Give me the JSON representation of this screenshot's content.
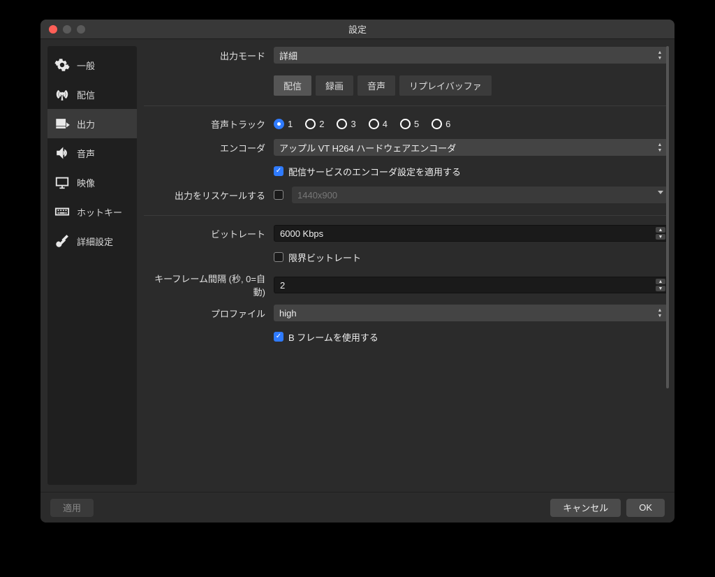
{
  "window": {
    "title": "設定"
  },
  "sidebar": {
    "items": [
      {
        "label": "一般"
      },
      {
        "label": "配信"
      },
      {
        "label": "出力"
      },
      {
        "label": "音声"
      },
      {
        "label": "映像"
      },
      {
        "label": "ホットキー"
      },
      {
        "label": "詳細設定"
      }
    ],
    "active_index": 2
  },
  "output_mode": {
    "label": "出力モード",
    "value": "詳細"
  },
  "tabs": [
    {
      "label": "配信"
    },
    {
      "label": "録画"
    },
    {
      "label": "音声"
    },
    {
      "label": "リプレイバッファ"
    }
  ],
  "tabs_active_index": 0,
  "audio_track": {
    "label": "音声トラック",
    "options": [
      "1",
      "2",
      "3",
      "4",
      "5",
      "6"
    ],
    "selected_index": 0
  },
  "encoder": {
    "label": "エンコーダ",
    "value": "アップル VT H264 ハードウェアエンコーダ"
  },
  "apply_service_settings": {
    "checked": true,
    "label": "配信サービスのエンコーダ設定を適用する"
  },
  "rescale": {
    "label": "出力をリスケールする",
    "checked": false,
    "placeholder": "1440x900"
  },
  "bitrate": {
    "label": "ビットレート",
    "value": "6000 Kbps"
  },
  "limit_bitrate": {
    "checked": false,
    "label": "限界ビットレート"
  },
  "keyframe": {
    "label": "キーフレーム間隔 (秒, 0=自動)",
    "value": "2"
  },
  "profile": {
    "label": "プロファイル",
    "value": "high"
  },
  "bframes": {
    "checked": true,
    "label": "B フレームを使用する"
  },
  "footer": {
    "apply": "適用",
    "cancel": "キャンセル",
    "ok": "OK"
  }
}
